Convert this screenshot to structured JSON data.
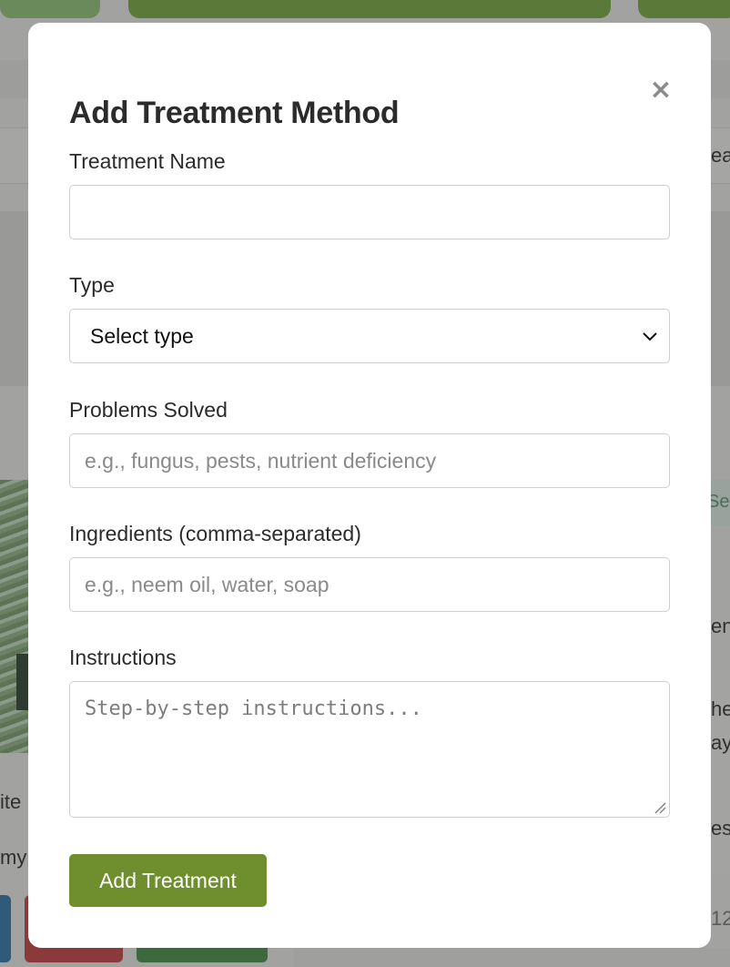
{
  "background": {
    "text_fragments": [
      "ea",
      "Set",
      "en",
      "he",
      "ay",
      "es",
      "ite",
      "my",
      "12"
    ]
  },
  "modal": {
    "title": "Add Treatment Method",
    "close_symbol": "×",
    "fields": {
      "name": {
        "label": "Treatment Name",
        "value": "",
        "placeholder": ""
      },
      "type": {
        "label": "Type",
        "selected": "Select type"
      },
      "problems": {
        "label": "Problems Solved",
        "value": "",
        "placeholder": "e.g., fungus, pests, nutrient deficiency"
      },
      "ingredients": {
        "label": "Ingredients (comma-separated)",
        "value": "",
        "placeholder": "e.g., neem oil, water, soap"
      },
      "instructions": {
        "label": "Instructions",
        "value": "",
        "placeholder": "Step-by-step instructions..."
      }
    },
    "submit_label": "Add Treatment"
  },
  "colors": {
    "accent": "#6f8f2f",
    "overlay": "#a2a2a1",
    "modal_bg": "#ffffff"
  }
}
